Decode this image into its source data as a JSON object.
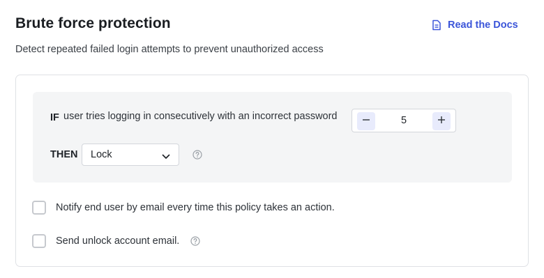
{
  "header": {
    "title": "Brute force protection",
    "subtitle": "Detect repeated failed login attempts to prevent unauthorized access",
    "docs_link": {
      "label": "Read the Docs",
      "icon": "document-icon"
    }
  },
  "rule": {
    "if_keyword": "IF",
    "if_text": "user tries logging in consecutively with an incorrect password",
    "attempts_value": "5",
    "decrement_symbol": "−",
    "increment_symbol": "+",
    "then_keyword": "THEN",
    "action_selected": "Lock"
  },
  "options": [
    {
      "label": "Notify end user by email every time this policy takes an action.",
      "checked": false
    },
    {
      "label": "Send unlock account email.",
      "checked": false
    }
  ],
  "colors": {
    "accent": "#3b55d9",
    "stepper_button_bg": "#e8ebfc",
    "rule_box_bg": "#f4f5f6",
    "border": "#dfe1e5"
  }
}
